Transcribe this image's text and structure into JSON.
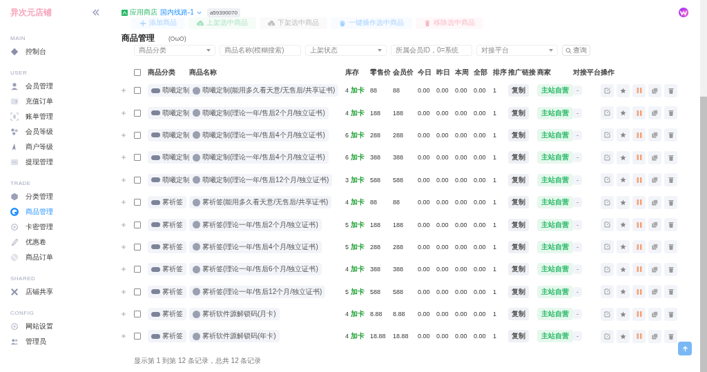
{
  "sidebar": {
    "logo": "异次元店铺",
    "sections": [
      {
        "title": "MAIN",
        "items": [
          {
            "label": "控制台",
            "selected": false
          }
        ]
      },
      {
        "title": "USER",
        "items": [
          {
            "label": "会员管理",
            "selected": false
          },
          {
            "label": "充值订单",
            "selected": false
          },
          {
            "label": "账单管理",
            "selected": false
          },
          {
            "label": "会员等级",
            "selected": false
          },
          {
            "label": "商户等级",
            "selected": false
          },
          {
            "label": "提现管理",
            "selected": false
          }
        ]
      },
      {
        "title": "TRADE",
        "items": [
          {
            "label": "分类管理",
            "selected": false
          },
          {
            "label": "商品管理",
            "selected": true
          },
          {
            "label": "卡密管理",
            "selected": false
          },
          {
            "label": "优惠卷",
            "selected": false
          },
          {
            "label": "商品订单",
            "selected": false
          }
        ]
      },
      {
        "title": "SHARED",
        "items": [
          {
            "label": "店铺共享",
            "selected": false
          }
        ]
      },
      {
        "title": "CONFIG",
        "items": [
          {
            "label": "网站设置",
            "selected": false
          },
          {
            "label": "管理员",
            "selected": false
          }
        ]
      }
    ]
  },
  "topbar": {
    "store": "应用商店",
    "route": "国内线路-1",
    "account": "a59390070"
  },
  "toolbar": [
    {
      "label": "添加商品",
      "kind": "add"
    },
    {
      "label": "上架选中商品",
      "kind": "up"
    },
    {
      "label": "下架选中商品",
      "kind": "down"
    },
    {
      "label": "一键操作选中商品",
      "kind": "hand"
    },
    {
      "label": "移除选中商品",
      "kind": "remove"
    }
  ],
  "page": {
    "title": "商品管理",
    "subtitle": "(OωO)"
  },
  "filters": [
    {
      "placeholder": "商品分类",
      "kind": "select"
    },
    {
      "placeholder": "商品名称(模糊搜索)",
      "kind": "input"
    },
    {
      "placeholder": "上架状态",
      "kind": "select"
    },
    {
      "placeholder": "所属会员ID，0=系统",
      "kind": "input"
    },
    {
      "placeholder": "对接平台",
      "kind": "select"
    }
  ],
  "search_button": "查询",
  "table": {
    "all_checked": false,
    "columns": [
      "商品分类",
      "商品名称",
      "库存",
      "零售价",
      "会员价",
      "今日",
      "昨日",
      "本周",
      "全部",
      "排序",
      "推广链接",
      "商家",
      "对接平台",
      "操作"
    ],
    "rows": [
      {
        "checked": false,
        "category": "萌曦定制",
        "name": "萌曦定制(能用多久看天意/无售后/共享证书)",
        "stock": "4",
        "add_card": "加卡",
        "retail": "88",
        "member": "88",
        "today": "0.00",
        "yesterday": "0.00",
        "week": "0.00",
        "all": "0.00",
        "sort": "1",
        "promo": "复制",
        "merchant": "主站自营",
        "platform": "-"
      },
      {
        "checked": false,
        "category": "萌曦定制",
        "name": "萌曦定制(理论一年/售后2个月/独立证书)",
        "stock": "4",
        "add_card": "加卡",
        "retail": "188",
        "member": "188",
        "today": "0.00",
        "yesterday": "0.00",
        "week": "0.00",
        "all": "0.00",
        "sort": "1",
        "promo": "复制",
        "merchant": "主站自营",
        "platform": "-"
      },
      {
        "checked": false,
        "category": "萌曦定制",
        "name": "萌曦定制(理论一年/售后4个月/独立证书)",
        "stock": "6",
        "add_card": "加卡",
        "retail": "288",
        "member": "288",
        "today": "0.00",
        "yesterday": "0.00",
        "week": "0.00",
        "all": "0.00",
        "sort": "1",
        "promo": "复制",
        "merchant": "主站自营",
        "platform": "-"
      },
      {
        "checked": false,
        "category": "萌曦定制",
        "name": "萌曦定制(理论一年/售后4个月/独立证书)",
        "stock": "6",
        "add_card": "加卡",
        "retail": "388",
        "member": "388",
        "today": "0.00",
        "yesterday": "0.00",
        "week": "0.00",
        "all": "0.00",
        "sort": "1",
        "promo": "复制",
        "merchant": "主站自营",
        "platform": "-"
      },
      {
        "checked": false,
        "category": "萌曦定制",
        "name": "萌曦定制(理论一年/售后12个月/独立证书)",
        "stock": "3",
        "add_card": "加卡",
        "retail": "588",
        "member": "588",
        "today": "0.00",
        "yesterday": "0.00",
        "week": "0.00",
        "all": "0.00",
        "sort": "1",
        "promo": "复制",
        "merchant": "主站自营",
        "platform": "-"
      },
      {
        "checked": false,
        "category": "雾祈签",
        "name": "雾祈签(能用多久看天意/无售后/共享证书)",
        "stock": "4",
        "add_card": "加卡",
        "retail": "88",
        "member": "88",
        "today": "0.00",
        "yesterday": "0.00",
        "week": "0.00",
        "all": "0.00",
        "sort": "1",
        "promo": "复制",
        "merchant": "主站自营",
        "platform": "-"
      },
      {
        "checked": false,
        "category": "雾祈签",
        "name": "雾祈签(理论一年/售后2个月/独立证书)",
        "stock": "5",
        "add_card": "加卡",
        "retail": "188",
        "member": "188",
        "today": "0.00",
        "yesterday": "0.00",
        "week": "0.00",
        "all": "0.00",
        "sort": "1",
        "promo": "复制",
        "merchant": "主站自营",
        "platform": "-"
      },
      {
        "checked": false,
        "category": "雾祈签",
        "name": "雾祈签(理论一年/售后4个月/独立证书)",
        "stock": "5",
        "add_card": "加卡",
        "retail": "288",
        "member": "288",
        "today": "0.00",
        "yesterday": "0.00",
        "week": "0.00",
        "all": "0.00",
        "sort": "1",
        "promo": "复制",
        "merchant": "主站自营",
        "platform": "-"
      },
      {
        "checked": false,
        "category": "雾祈签",
        "name": "雾祈签(理论一年/售后6个月/独立证书)",
        "stock": "4",
        "add_card": "加卡",
        "retail": "388",
        "member": "388",
        "today": "0.00",
        "yesterday": "0.00",
        "week": "0.00",
        "all": "0.00",
        "sort": "1",
        "promo": "复制",
        "merchant": "主站自营",
        "platform": "-"
      },
      {
        "checked": false,
        "category": "雾祈签",
        "name": "雾祈签(理论一年/售后12个月/独立证书)",
        "stock": "5",
        "add_card": "加卡",
        "retail": "588",
        "member": "588",
        "today": "0.00",
        "yesterday": "0.00",
        "week": "0.00",
        "all": "0.00",
        "sort": "1",
        "promo": "复制",
        "merchant": "主站自营",
        "platform": "-"
      },
      {
        "checked": false,
        "category": "雾祈签",
        "name": "雾祈软件源解锁码(月卡)",
        "stock": "4",
        "add_card": "加卡",
        "retail": "8.88",
        "member": "8.88",
        "today": "0.00",
        "yesterday": "0.00",
        "week": "0.00",
        "all": "0.00",
        "sort": "1",
        "promo": "复制",
        "merchant": "主站自营",
        "platform": "-"
      },
      {
        "checked": false,
        "category": "雾祈签",
        "name": "雾祈软件源解锁码(年卡)",
        "stock": "4",
        "add_card": "加卡",
        "retail": "18.88",
        "member": "18.88",
        "today": "0.00",
        "yesterday": "0.00",
        "week": "0.00",
        "all": "0.00",
        "sort": "1",
        "promo": "复制",
        "merchant": "主站自营",
        "platform": "-"
      }
    ]
  },
  "footer": "显示第 1 到第 12 条记录，总共 12 条记录"
}
